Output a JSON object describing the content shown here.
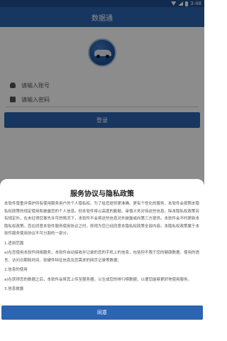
{
  "status_bar": {
    "time": "3:48"
  },
  "app_bar": {
    "title": "数据通"
  },
  "login": {
    "account_placeholder": "请输入账号",
    "password_placeholder": "请输入密码",
    "login_label": "登录"
  },
  "dialog": {
    "title": "服务协议与隐私政策",
    "paragraphs": [
      "本软件尊重并保护所有使用服务用户的个人隐私权。为了给您提供更准确、更有个性化的服务，本软件会按照本隐私权政策的规定使用和披露您的个人信息。但本软件将以高度的勤勉、审慎义务对待这些信息。除本隐私权政策另有规定外，在未征得您事先许可的情况下，本软件不会将这些信息对外披露或向第三方提供。本软件会不时更新本隐私权政策。您在同意本软件服务使用协议之时，即视为您已经同意本隐私权政策全部内容。本隐私权政策属于本软件服务使用协议不可分割的一部分。",
      "1.适用范围",
      "a)在您使用本软件网络服务，本软件自动接收并记录的您的手机上的信息，包括但不限于您的健康数据、使用的语言、访问日期和时间、软硬件特征信息及您需求的网页记录等数据；",
      "2.信息的使用",
      "a)在获得您的数据之后，本软件会将其上传至服务器，以生成您的排行榜数据，以便您能够更好地使用服务。",
      "3.信息披露"
    ],
    "agree_label": "同意"
  }
}
